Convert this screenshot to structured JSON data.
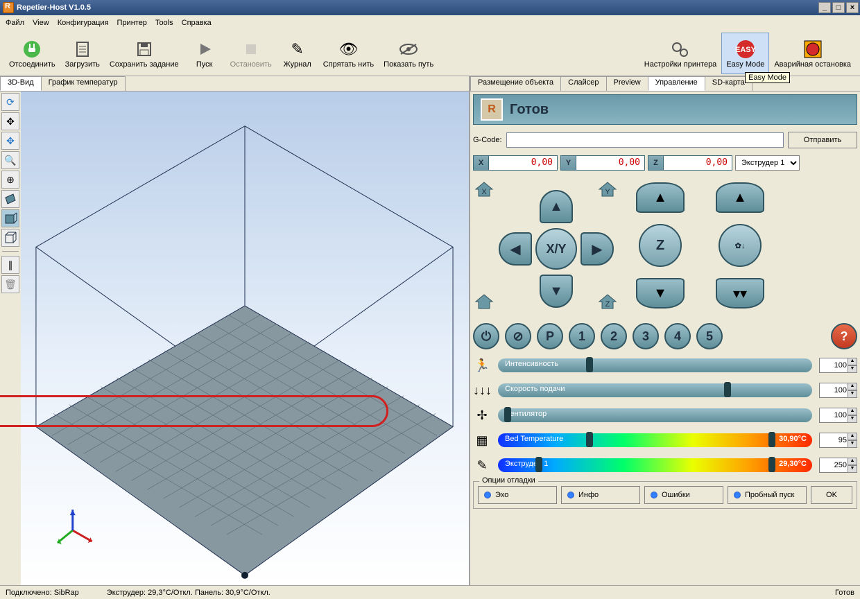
{
  "window": {
    "title": "Repetier-Host V1.0.5"
  },
  "menu": {
    "file": "Файл",
    "view": "View",
    "config": "Конфигурация",
    "printer": "Принтер",
    "tools": "Tools",
    "help": "Справка"
  },
  "toolbar": {
    "disconnect": "Отсоединить",
    "load": "Загрузить",
    "save_job": "Сохранить задание",
    "start": "Пуск",
    "stop": "Остановить",
    "log": "Журнал",
    "hide_fil": "Спрятать нить",
    "show_path": "Показать путь",
    "printer_settings": "Настройки принтера",
    "easy_mode": "Easy Mode",
    "estop": "Аварийная остановка",
    "tooltip_easy": "Easy Mode"
  },
  "left_tabs": {
    "view3d": "3D-Вид",
    "temp_graph": "График температур"
  },
  "right_tabs": {
    "object": "Размещение объекта",
    "slicer": "Слайсер",
    "preview": "Preview",
    "control": "Управление",
    "sd": "SD-карта"
  },
  "status": {
    "label": "Готов"
  },
  "gcode": {
    "label": "G-Code:",
    "value": "",
    "send": "Отправить"
  },
  "pos": {
    "x_lbl": "X",
    "x_val": "0,00",
    "y_lbl": "Y",
    "y_val": "0,00",
    "z_lbl": "Z",
    "z_val": "0,00"
  },
  "extruder_select": {
    "value": "Экструдер 1"
  },
  "jog": {
    "xy": "X/Y",
    "z": "Z"
  },
  "sliders": {
    "speed": {
      "label": "Интенсивность",
      "value": "100"
    },
    "flow": {
      "label": "Скорость подачи",
      "value": "100"
    },
    "fan": {
      "label": "Вентилятор",
      "value": "100"
    },
    "bed": {
      "label": "Bed Temperature",
      "temp": "30,90°C",
      "value": "95"
    },
    "ext": {
      "label": "Экструдер 1",
      "temp": "29,30°C",
      "value": "250"
    }
  },
  "debug": {
    "legend": "Опции отладки",
    "echo": "Эхо",
    "info": "Инфо",
    "errors": "Ошибки",
    "dryrun": "Пробный пуск",
    "ok": "OK"
  },
  "statusbar": {
    "connected": "Подключено: SibRap",
    "temps": "Экструдер: 29,3°C/Откл. Панель: 30,9°C/Откл.",
    "idle": "Готов"
  }
}
